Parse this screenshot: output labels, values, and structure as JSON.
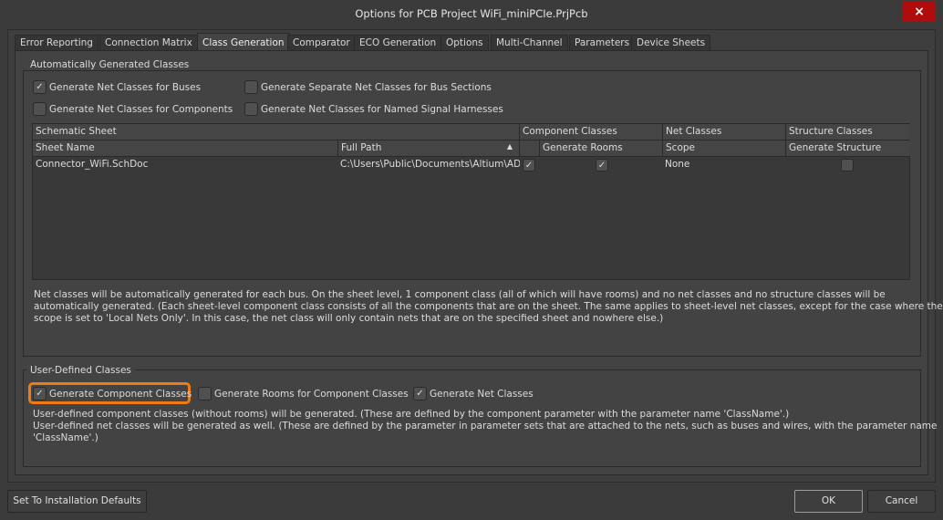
{
  "window": {
    "title": "Options for PCB Project WiFi_miniPCIe.PrjPcb",
    "close_icon": "×"
  },
  "tabs": [
    "Error Reporting",
    "Connection Matrix",
    "Class Generation",
    "Comparator",
    "ECO Generation",
    "Options",
    "Multi-Channel",
    "Parameters",
    "Device Sheets"
  ],
  "selected_tab": "Class Generation",
  "auto": {
    "title": "Automatically Generated Classes",
    "options": [
      {
        "label": "Generate Net Classes for Buses",
        "checked": true
      },
      {
        "label": "Generate Separate Net Classes for Bus Sections",
        "checked": false
      },
      {
        "label": "Generate Net Classes for Components",
        "checked": false
      },
      {
        "label": "Generate Net Classes for Named Signal Harnesses",
        "checked": false
      }
    ],
    "table": {
      "group_headers": [
        "Schematic Sheet",
        "Component Classes",
        "Net Classes",
        "Structure Classes"
      ],
      "headers": [
        "Sheet Name",
        "Full Path",
        "",
        "Generate Rooms",
        "Scope",
        "Generate Structure"
      ],
      "rows": [
        {
          "sheet_name": "Connector_WiFi.SchDoc",
          "full_path": "C:\\Users\\Public\\Documents\\Altium\\AD",
          "component_classes": true,
          "generate_rooms": true,
          "scope": "None",
          "generate_structure": false
        }
      ]
    },
    "description": [
      "Net classes will be automatically generated for each bus. On the sheet level, 1 component class (all of which will have rooms) and no net classes and no structure classes will be",
      "automatically generated. (Each sheet-level component class consists of all the components that are on the sheet. The same applies to sheet-level net classes, except for the case where the",
      "scope is set to 'Local Nets Only'. In this case, the net class will only contain nets that are on the specified sheet and nowhere else.)"
    ]
  },
  "user": {
    "title": "User-Defined Classes",
    "options": [
      {
        "label": "Generate Component Classes",
        "checked": true
      },
      {
        "label": "Generate Rooms for Component Classes",
        "checked": false
      },
      {
        "label": "Generate Net Classes",
        "checked": true
      }
    ],
    "description": [
      "User-defined component classes (without rooms) will be generated. (These are defined by the component parameter with the parameter name 'ClassName'.)",
      "User-defined net classes will be generated as well. (These are defined by the parameter in parameter sets that are attached to the nets, such as buses and wires, with the parameter name",
      "'ClassName'.)"
    ]
  },
  "buttons": {
    "defaults": "Set To Installation Defaults",
    "ok": "OK",
    "cancel": "Cancel"
  },
  "colors": {
    "highlight": "#f07a16",
    "close": "#b00c0c"
  }
}
